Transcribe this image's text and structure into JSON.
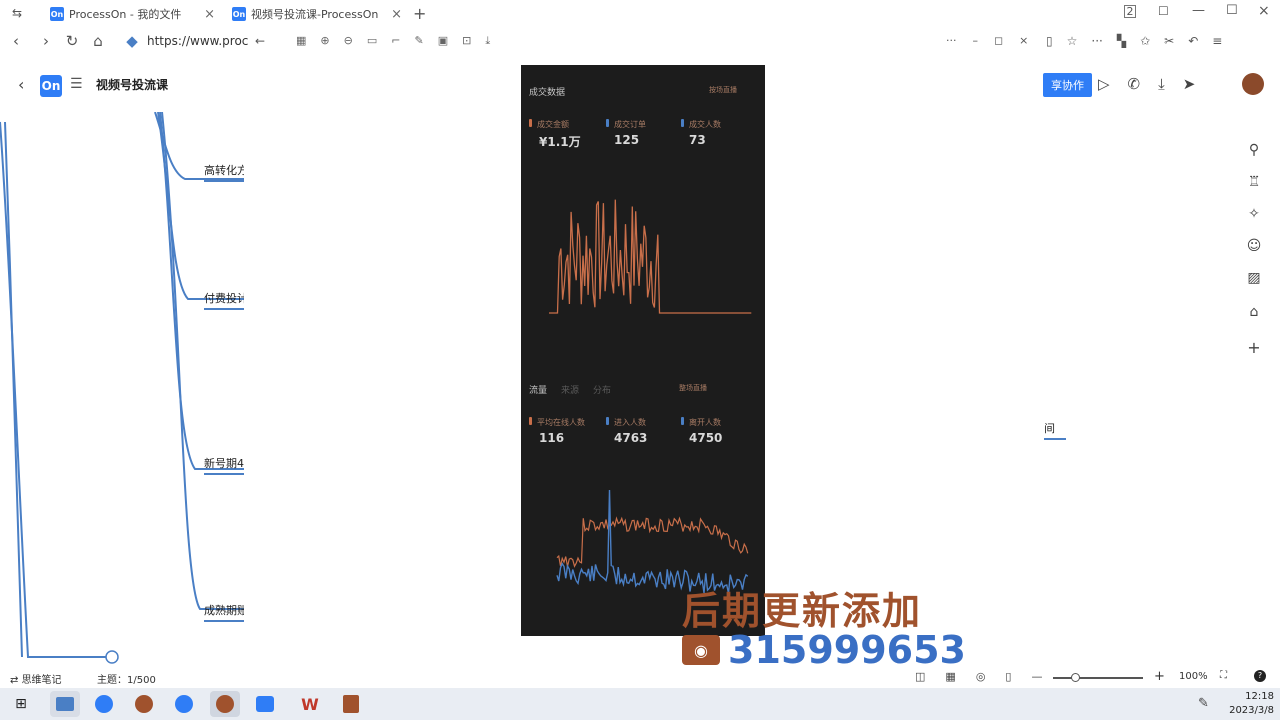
{
  "browser": {
    "tabs": [
      {
        "icon": "On",
        "title": "ProcessOn - 我的文件"
      },
      {
        "icon": "On",
        "title": "视频号投流课-ProcessOn"
      }
    ],
    "url": "https://www.proc",
    "new_tab": "+"
  },
  "app": {
    "logo": "On",
    "doc_title": "视频号投流课",
    "collab_button": "享协作"
  },
  "mindmap": {
    "branches": [
      "高转化方",
      "付费投计划",
      "新号期4",
      "成熟期账"
    ],
    "right_node": "间"
  },
  "phone": {
    "section1": {
      "title": "成交数据",
      "filter": "按场直播",
      "metrics": [
        {
          "label": "成交金额",
          "value": "¥1.1万",
          "color": "#c96f4a"
        },
        {
          "label": "成交订单",
          "value": "125",
          "color": "#4a7fc5"
        },
        {
          "label": "成交人数",
          "value": "73",
          "color": "#4a7fc5"
        }
      ]
    },
    "section2": {
      "tabs": [
        "流量",
        "来源",
        "分布"
      ],
      "filter": "整场直播",
      "metrics": [
        {
          "label": "平均在线人数",
          "value": "116",
          "color": "#c96f4a"
        },
        {
          "label": "进入人数",
          "value": "4763",
          "color": "#4a7fc5"
        },
        {
          "label": "离开人数",
          "value": "4750",
          "color": "#4a7fc5"
        }
      ]
    }
  },
  "overlay": {
    "line1": "后期更新添加",
    "line2": "315999653"
  },
  "statusbar": {
    "mode": "思维笔记",
    "topics": "主题：1/500",
    "zoom": "100%"
  },
  "taskbar": {
    "time": "12:18",
    "date": "2023/3/8"
  }
}
